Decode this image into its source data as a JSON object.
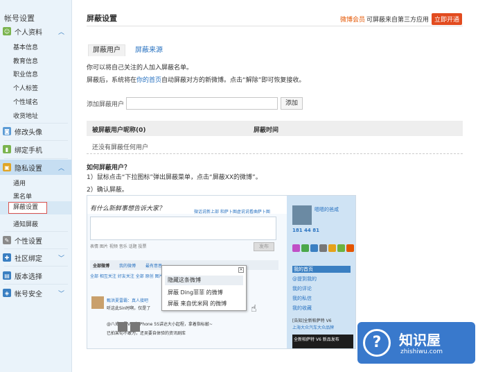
{
  "sidebar": {
    "title": "帐号设置",
    "personal": {
      "label": "个人资料",
      "items": [
        "基本信息",
        "教育信息",
        "职业信息",
        "个人标签",
        "个性域名",
        "收货地址"
      ]
    },
    "avatar": "修改头像",
    "phone": "绑定手机",
    "privacy": {
      "label": "隐私设置",
      "items": [
        "通用",
        "黑名单",
        "屏蔽设置",
        "通知屏蔽"
      ]
    },
    "personalize": "个性设置",
    "social": "社区绑定",
    "version": "版本选择",
    "security": "帐号安全"
  },
  "header": {
    "title": "屏蔽设置",
    "vip_link": "微博会员",
    "vip_text": "可屏蔽来自第三方应用",
    "vip_button": "立即开通"
  },
  "tabs": {
    "active": "屏蔽用户",
    "other": "屏蔽来源"
  },
  "desc": {
    "line1": "你可以将自己关注的人加入屏蔽名单。",
    "line2_a": "屏蔽后，系统将在",
    "line2_link": "你的首页",
    "line2_b": "自动屏蔽对方的新微博。点击“解除”即可恢复接收。"
  },
  "add": {
    "label": "添加屏蔽用户",
    "input_value": "",
    "button": "添加"
  },
  "table": {
    "col1": "被屏蔽用户昵称(0)",
    "col2": "屏蔽时间",
    "empty": "还没有屏蔽任何用户"
  },
  "howto": {
    "title": "如何屏蔽用户？",
    "step1": "1）鼠标点击“下拉图标”弹出屏蔽菜单，点击“屏蔽XX的微博”。",
    "step2": "2）确认屏蔽。"
  },
  "screenshot": {
    "heading": "有什么新鲜事想告诉大家？",
    "top_hint": "微话说新上部 和萨卜图虚说说看曲萨卜图",
    "tools": "表情 图片 视频 音乐 话题 投票",
    "send": "发布",
    "tabs": [
      "全部微博",
      "我的微博",
      "最有意思"
    ],
    "sub": "全部   相互关注   好友关注   全部   原创   图片   视频",
    "feed1": "甄洪夏雷霸：真人接吧",
    "feed2": "听这此Sin时啊，仅是了",
    "feed3": "@八戒不是V：在iPhone 5S讲达大小起程，拿着指标敲~",
    "feed4": "已拍某旬不敢为，还吴要自体验的资讯剧库",
    "popup_title": "隐藏这条微博",
    "popup_item1": "屏蔽 Ding菲菲 的微博",
    "popup_item2": "屏蔽 来自优米网 的微博",
    "profile_name": "嗯嗯的爸咸",
    "profile_nums": "181  44  81",
    "menu": [
      "我的首页",
      "@提到我的",
      "我的评论",
      "我的私信",
      "我的收藏"
    ],
    "ad_line1": "[告知]全新帕萨特 V6",
    "ad_line2": "上海大众汽车大众品牌",
    "ad_box": "全新帕萨特 V6 新品发布"
  },
  "watermark": {
    "brand": "知识屋",
    "site": "zhishiwu.com"
  }
}
